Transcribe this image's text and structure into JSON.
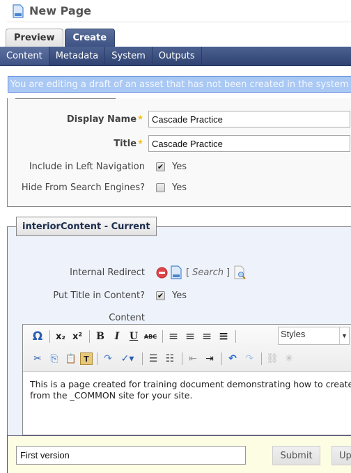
{
  "header": {
    "title": "New Page",
    "icon": "page-icon"
  },
  "top_tabs": [
    {
      "label": "Preview",
      "active": false
    },
    {
      "label": "Create",
      "active": true
    }
  ],
  "sub_tabs": [
    {
      "label": "Content",
      "active": true
    },
    {
      "label": "Metadata",
      "active": false
    },
    {
      "label": "System",
      "active": false
    },
    {
      "label": "Outputs",
      "active": false
    }
  ],
  "banner": {
    "text": "You are editing a draft of an asset that has not been created in the system yet."
  },
  "basic_fields": {
    "display_name": {
      "label": "Display Name",
      "required": true,
      "value": "Cascade Practice"
    },
    "title": {
      "label": "Title",
      "required": true,
      "value": "Cascade Practice"
    },
    "include_left_nav": {
      "label": "Include in Left Navigation",
      "checked": true,
      "option": "Yes",
      "check_glyph": "✔"
    },
    "hide_search": {
      "label": "Hide From Search Engines?",
      "checked": false,
      "option": "Yes",
      "check_glyph": ""
    },
    "required_star": "★"
  },
  "interior": {
    "legend": "interiorContent - Current",
    "internal_redirect": {
      "label": "Internal Redirect",
      "search_open": "[",
      "search_text": "Search",
      "search_close": "]"
    },
    "put_title": {
      "label": "Put Title in Content?",
      "checked": true,
      "option": "Yes",
      "check_glyph": "✔"
    },
    "content_label": "Content"
  },
  "editor": {
    "toolbar_row1": [
      {
        "name": "special-char",
        "glyph": "Ω"
      },
      {
        "sep": true
      },
      {
        "name": "subscript",
        "glyph": "x₂"
      },
      {
        "name": "superscript",
        "glyph": "x²"
      },
      {
        "sep": true
      },
      {
        "name": "bold",
        "glyph": "B"
      },
      {
        "name": "italic",
        "glyph": "I"
      },
      {
        "name": "underline",
        "glyph": "U"
      },
      {
        "name": "strikethrough",
        "glyph": "ABC"
      },
      {
        "sep": true
      },
      {
        "name": "align-left",
        "glyph": "≡"
      },
      {
        "name": "align-center",
        "glyph": "≡"
      },
      {
        "name": "align-right",
        "glyph": "≡"
      },
      {
        "name": "align-justify",
        "glyph": "≡"
      },
      {
        "sep": true
      }
    ],
    "toolbar_row2": [
      {
        "name": "cut",
        "glyph": "✂"
      },
      {
        "name": "copy",
        "glyph": "⎘"
      },
      {
        "name": "paste",
        "glyph": "📋"
      },
      {
        "name": "paste-text",
        "glyph": "T"
      },
      {
        "sep": true
      },
      {
        "name": "find-replace",
        "glyph": "↷"
      },
      {
        "name": "spellcheck",
        "glyph": "✓▾"
      },
      {
        "sep": true
      },
      {
        "name": "bullet-list",
        "glyph": "☰"
      },
      {
        "name": "numbered-list",
        "glyph": "☷"
      },
      {
        "sep": true
      },
      {
        "name": "outdent",
        "glyph": "⇤"
      },
      {
        "name": "indent",
        "glyph": "⇥"
      },
      {
        "sep": true
      },
      {
        "name": "undo",
        "glyph": "↶"
      },
      {
        "name": "redo",
        "glyph": "↷"
      },
      {
        "sep": true
      },
      {
        "name": "link",
        "glyph": "⛓"
      },
      {
        "name": "unlink",
        "glyph": "✳"
      }
    ],
    "styles_select": {
      "value": "Styles",
      "arrow": "▼"
    },
    "body_lines": [
      "This is a page created for training document demonstrating how to create a page",
      "from the _COMMON site for your site."
    ]
  },
  "footer": {
    "comment_value": "First version",
    "submit_label": "Submit",
    "update_label": "Update"
  },
  "colors": {
    "nav_bar": "#3b4f80",
    "banner_bg": "#a9c8f4",
    "footer_bg": "#fdfde4",
    "interior_bg": "#eef3fb"
  }
}
